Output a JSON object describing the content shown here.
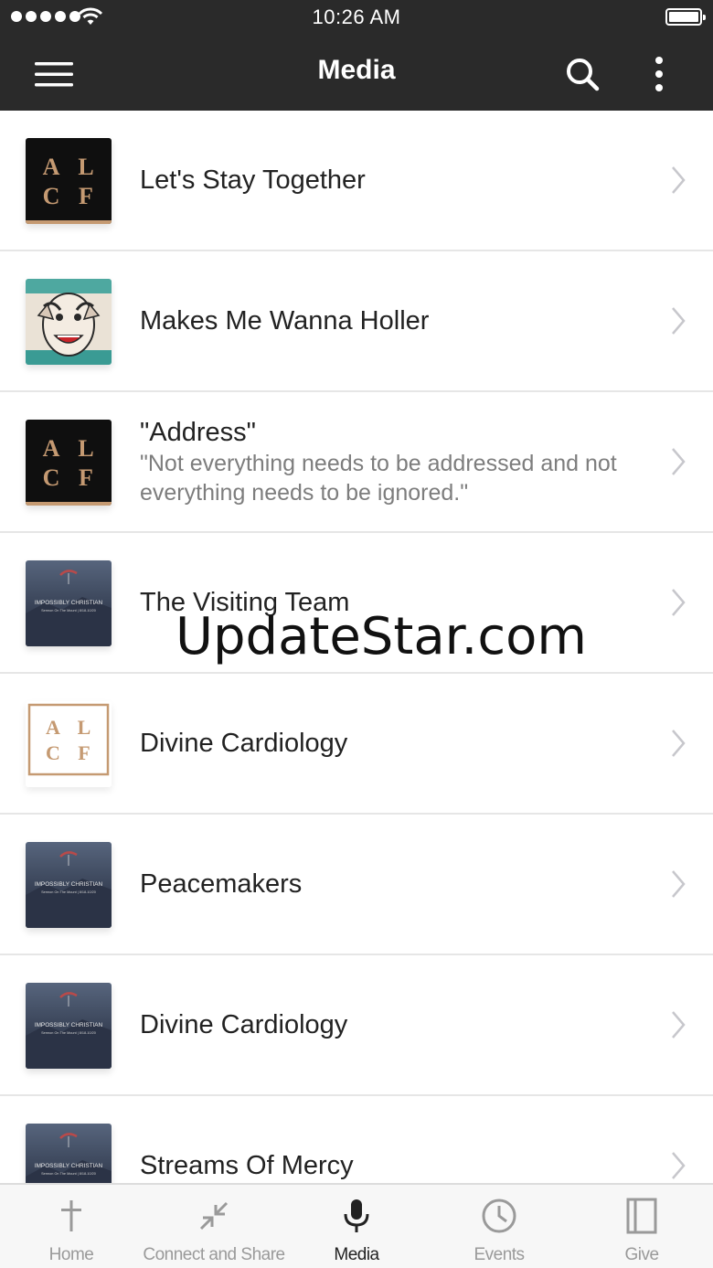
{
  "status_bar": {
    "time": "10:26 AM"
  },
  "header": {
    "title": "Media",
    "icons": {
      "menu": "hamburger-menu-icon",
      "search": "search-icon",
      "more": "more-vertical-icon"
    }
  },
  "media_items": [
    {
      "title": "Let's Stay Together",
      "subtitle": "",
      "thumbnail": "alcf-logo-dark"
    },
    {
      "title": "Makes Me Wanna Holler",
      "subtitle": "",
      "thumbnail": "illustration-face"
    },
    {
      "title": "\"Address\"",
      "subtitle": "\"Not everything needs to be addressed and not everything needs to be ignored.\"",
      "thumbnail": "alcf-logo-dark"
    },
    {
      "title": "The Visiting Team",
      "subtitle": "",
      "thumbnail": "impossibly-christian"
    },
    {
      "title": "Divine Cardiology",
      "subtitle": "",
      "thumbnail": "alcf-logo-light"
    },
    {
      "title": "Peacemakers",
      "subtitle": "",
      "thumbnail": "impossibly-christian"
    },
    {
      "title": "Divine Cardiology",
      "subtitle": "",
      "thumbnail": "impossibly-christian"
    },
    {
      "title": "Streams Of Mercy",
      "subtitle": "",
      "thumbnail": "impossibly-christian"
    }
  ],
  "thumbnail_text": {
    "logo_letters": [
      "A",
      "L",
      "C",
      "F"
    ],
    "series_title": "IMPOSSIBLY CHRISTIAN",
    "series_subtitle": "Sermon On The Mount | 8/18-10/20"
  },
  "watermark": "UpdateStar.com",
  "tab_bar": {
    "tabs": [
      {
        "label": "Home",
        "icon": "cross-icon",
        "active": false
      },
      {
        "label": "Connect and Share",
        "icon": "arrows-in-icon",
        "active": false
      },
      {
        "label": "Media",
        "icon": "microphone-icon",
        "active": true
      },
      {
        "label": "Events",
        "icon": "clock-icon",
        "active": false
      },
      {
        "label": "Give",
        "icon": "book-icon",
        "active": false
      }
    ]
  },
  "colors": {
    "header_bg": "#2a2a2a",
    "logo_accent": "#c59a72",
    "logo_dark_bg": "#0f0f0f",
    "tab_active": "#222222",
    "tab_inactive": "#9a9a9a"
  }
}
